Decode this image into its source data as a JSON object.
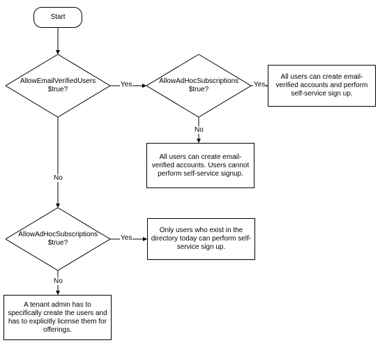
{
  "nodes": {
    "start": {
      "label": "Start"
    },
    "d1": {
      "label": "AllowEmailVerifiedUsers $true?"
    },
    "d2": {
      "label": "AllowAdHocSubscriptions $true?"
    },
    "d3": {
      "label": "AllowAdHocSubscriptions $true?"
    },
    "r1": {
      "label": "All users can create email-verified accounts and perform self-service sign up."
    },
    "r2": {
      "label": "All users can create email-verified accounts. Users cannot perform self-service signup."
    },
    "r3": {
      "label": "Only users who exist in the directory today can perform self-service sign up."
    },
    "r4": {
      "label": "A tenant admin has to specifically create the users and has to explicitly license them for offerings."
    }
  },
  "edges": {
    "yes": "Yes",
    "no": "No"
  },
  "chart_data": {
    "type": "flowchart",
    "nodes": [
      {
        "id": "start",
        "kind": "terminator",
        "text": "Start"
      },
      {
        "id": "d1",
        "kind": "decision",
        "text": "AllowEmailVerifiedUsers $true?"
      },
      {
        "id": "d2",
        "kind": "decision",
        "text": "AllowAdHocSubscriptions $true?"
      },
      {
        "id": "d3",
        "kind": "decision",
        "text": "AllowAdHocSubscriptions $true?"
      },
      {
        "id": "r1",
        "kind": "process",
        "text": "All users can create email-verified accounts and perform self-service sign up."
      },
      {
        "id": "r2",
        "kind": "process",
        "text": "All users can create email-verified accounts. Users cannot perform self-service signup."
      },
      {
        "id": "r3",
        "kind": "process",
        "text": "Only users who exist in the directory today can perform self-service sign up."
      },
      {
        "id": "r4",
        "kind": "process",
        "text": "A tenant admin has to specifically create the users and has to explicitly license them for offerings."
      }
    ],
    "edges": [
      {
        "from": "start",
        "to": "d1",
        "label": ""
      },
      {
        "from": "d1",
        "to": "d2",
        "label": "Yes"
      },
      {
        "from": "d1",
        "to": "d3",
        "label": "No"
      },
      {
        "from": "d2",
        "to": "r1",
        "label": "Yes"
      },
      {
        "from": "d2",
        "to": "r2",
        "label": "No"
      },
      {
        "from": "d3",
        "to": "r3",
        "label": "Yes"
      },
      {
        "from": "d3",
        "to": "r4",
        "label": "No"
      }
    ]
  }
}
